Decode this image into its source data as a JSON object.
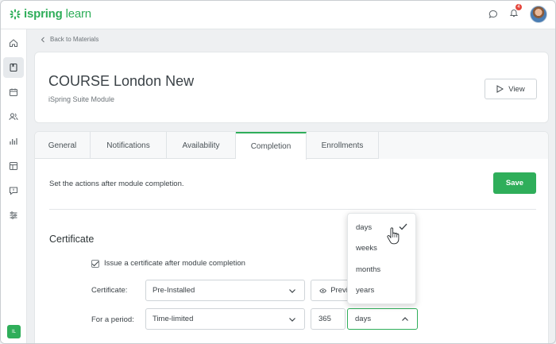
{
  "brand": {
    "logo_text_bold": "ispring",
    "logo_text_light": "learn",
    "accent": "#2fae5a"
  },
  "topbar": {
    "notifications_count": "4",
    "icons": [
      "chat-icon",
      "bell-icon",
      "avatar"
    ]
  },
  "sidebar": {
    "icons": [
      "home-icon",
      "book-icon",
      "calendar-icon",
      "users-icon",
      "chart-icon",
      "layout-icon",
      "feedback-icon",
      "settings-sliders-icon"
    ],
    "user_initials": "IL"
  },
  "breadcrumb": {
    "back_label": "Back to Materials"
  },
  "header": {
    "title": "COURSE London New",
    "subtitle": "iSpring Suite Module",
    "view_label": "View"
  },
  "tabs": [
    {
      "label": "General"
    },
    {
      "label": "Notifications"
    },
    {
      "label": "Availability"
    },
    {
      "label": "Completion",
      "active": true
    },
    {
      "label": "Enrollments"
    }
  ],
  "completion": {
    "description": "Set the actions after module completion.",
    "save_label": "Save",
    "certificate_title": "Certificate",
    "issue_checkbox_label": "Issue a certificate after module completion",
    "issue_checked": true,
    "certificate_label": "Certificate:",
    "certificate_value": "Pre-Installed",
    "preview_label": "Preview",
    "period_label": "For a period:",
    "period_value": "Time-limited",
    "period_amount": "365",
    "period_unit": "days"
  },
  "unit_dropdown": {
    "options": [
      "days",
      "weeks",
      "months",
      "years"
    ],
    "selected": "days"
  }
}
